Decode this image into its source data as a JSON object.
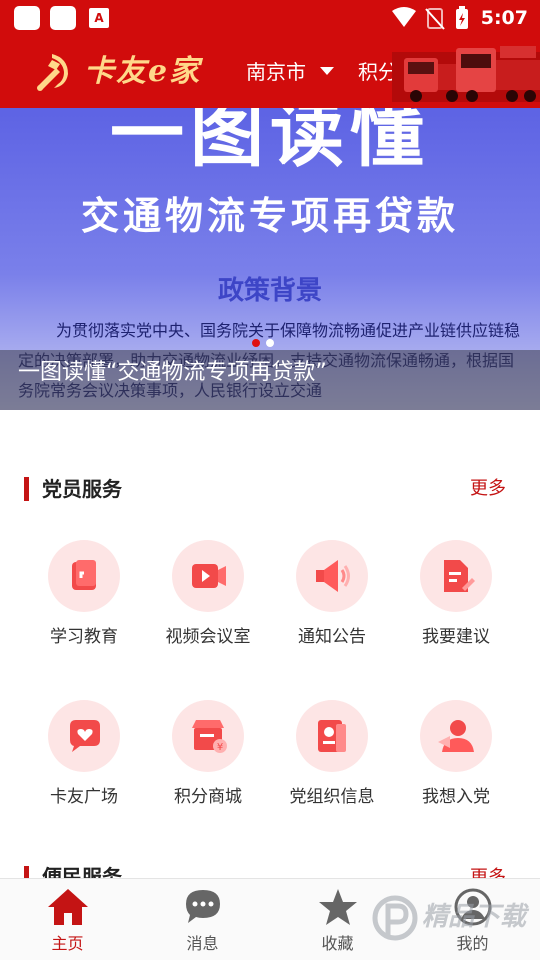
{
  "status_bar": {
    "time": "5:07",
    "app_badge": "A"
  },
  "header": {
    "app_title": "卡友e家",
    "city": "南京市",
    "points_label": "积分"
  },
  "banner": {
    "headline": "一图读懂",
    "subtitle": "交通物流专项再贷款",
    "section_heading": "政策背景",
    "body_text": "为贯彻落实党中央、国务院关于保障物流畅通促进产业链供应链稳定的决策部署，助力交通物流业纾困，支持交通物流保通畅通，根据国务院常务会议决策事项，人民银行设立交通",
    "caption": "一图读懂“交通物流专项再贷款”",
    "slide_count": 2,
    "active_slide": 1
  },
  "party_services": {
    "title": "党员服务",
    "more_label": "更多",
    "items": [
      {
        "label": "学习教育",
        "icon": "study-icon"
      },
      {
        "label": "视频会议室",
        "icon": "video-conference-icon"
      },
      {
        "label": "通知公告",
        "icon": "announcement-icon"
      },
      {
        "label": "我要建议",
        "icon": "suggestion-icon"
      },
      {
        "label": "卡友广场",
        "icon": "community-icon"
      },
      {
        "label": "积分商城",
        "icon": "points-mall-icon"
      },
      {
        "label": "党组织信息",
        "icon": "party-org-icon"
      },
      {
        "label": "我想入党",
        "icon": "join-party-icon"
      }
    ]
  },
  "convenience_services": {
    "title": "便民服务",
    "more_label": "更多"
  },
  "tabbar": {
    "tabs": [
      {
        "label": "主页",
        "icon": "home-icon",
        "active": true
      },
      {
        "label": "消息",
        "icon": "message-icon",
        "active": false
      },
      {
        "label": "收藏",
        "icon": "star-icon",
        "active": false
      },
      {
        "label": "我的",
        "icon": "profile-icon",
        "active": false
      }
    ]
  },
  "watermark": {
    "text": "精品下载"
  },
  "colors": {
    "brand_red": "#d10c0c",
    "accent_red": "#c41414",
    "icon_bg": "#fde5e5",
    "banner_blue": "#6d73e8"
  }
}
